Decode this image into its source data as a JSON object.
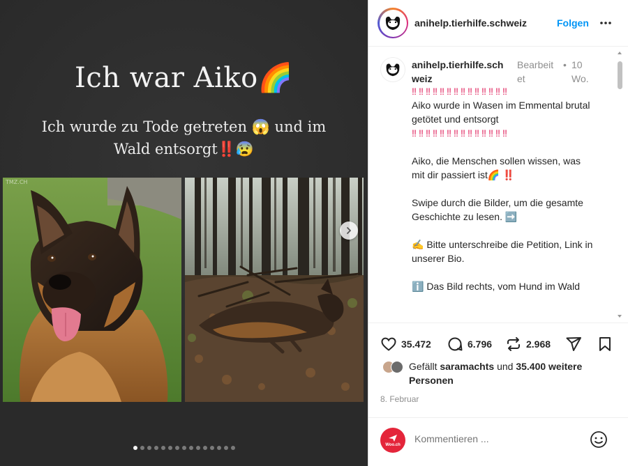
{
  "post": {
    "slide": {
      "title": "Ich war Aiko🌈",
      "subtitle": "Ich wurde zu Tode getreten 😱 und im Wald entsorgt‼️😰",
      "watermark_left": "TMZ.CH",
      "total_slides": 15,
      "active_slide": 0
    },
    "account": {
      "username": "anihelp.tierhilfe.schweiz",
      "follow_label": "Folgen"
    },
    "caption": {
      "username": "anihelp.tierhilfe.sch weiz",
      "edited": "Bearbeit et",
      "separator": "•",
      "time": "10 Wo.",
      "bangs_line1": "‼‼‼‼‼‼‼‼‼‼‼‼‼‼",
      "text1": "Aiko wurde in Wasen im Emmental brutal getötet und entsorgt",
      "bangs_line2": "‼‼‼‼‼‼‼‼‼‼‼‼‼‼",
      "text2": "Aiko, die Menschen sollen wissen, was mit dir passiert ist🌈 ‼️",
      "text3": "Swipe durch die Bilder, um die gesamte Geschichte zu lesen. ➡️",
      "text4": "✍️ Bitte unterschreibe die Petition, Link in unserer Bio.",
      "text5": "ℹ️ Das Bild rechts, vom Hund im Wald"
    },
    "actions": {
      "likes": "35.472",
      "comments": "6.796",
      "reposts": "2.968"
    },
    "liked_by": {
      "prefix": "Gefällt",
      "user": "saramachts",
      "middle": "und",
      "others": "35.400 weitere Personen"
    },
    "date": "8. Februar",
    "comment_box": {
      "placeholder": "Kommentieren ...",
      "avatar_label": "Woo.ch"
    }
  },
  "colors": {
    "accent": "#0095f6",
    "slide_background": "#2b2b2b",
    "bang": "#e0245e",
    "avatar_red": "#e4253a"
  },
  "icons": [
    "chevron-right-icon",
    "more-icon",
    "heart-icon",
    "comment-icon",
    "repost-icon",
    "share-icon",
    "bookmark-icon",
    "emoji-icon"
  ]
}
